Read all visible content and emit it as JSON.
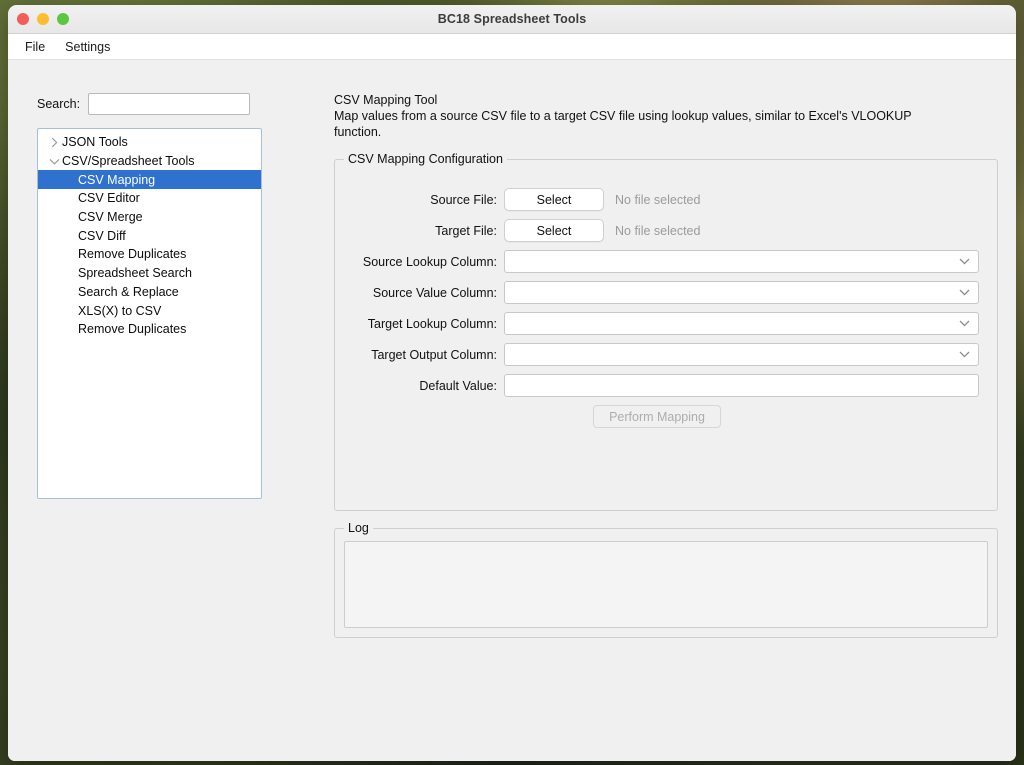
{
  "window": {
    "title": "BC18 Spreadsheet Tools",
    "traffic_lights": [
      "close-red",
      "minimize-yellow",
      "maximize-green"
    ]
  },
  "menubar": {
    "items": [
      {
        "label": "File"
      },
      {
        "label": "Settings"
      }
    ]
  },
  "sidebar": {
    "search": {
      "label": "Search:",
      "value": "",
      "placeholder": ""
    },
    "tree": [
      {
        "label": "JSON Tools",
        "level": 1,
        "arrow": "chevron-right-icon",
        "selected": false
      },
      {
        "label": "CSV/Spreadsheet Tools",
        "level": 1,
        "arrow": "chevron-down-icon",
        "selected": false
      },
      {
        "label": "CSV Mapping",
        "level": 2,
        "arrow": "",
        "selected": true
      },
      {
        "label": "CSV Editor",
        "level": 2,
        "arrow": "",
        "selected": false
      },
      {
        "label": "CSV Merge",
        "level": 2,
        "arrow": "",
        "selected": false
      },
      {
        "label": "CSV Diff",
        "level": 2,
        "arrow": "",
        "selected": false
      },
      {
        "label": "Remove Duplicates",
        "level": 2,
        "arrow": "",
        "selected": false
      },
      {
        "label": "Spreadsheet Search",
        "level": 2,
        "arrow": "",
        "selected": false
      },
      {
        "label": "Search & Replace",
        "level": 2,
        "arrow": "",
        "selected": false
      },
      {
        "label": "XLS(X) to CSV",
        "level": 2,
        "arrow": "",
        "selected": false
      },
      {
        "label": "Remove Duplicates",
        "level": 2,
        "arrow": "",
        "selected": false
      }
    ],
    "selection_color": "#2f71cf"
  },
  "main": {
    "tool_title": "CSV Mapping Tool",
    "tool_description": "Map values from a source CSV file to a target CSV file using lookup values, similar to Excel's VLOOKUP function.",
    "config": {
      "legend": "CSV Mapping Configuration",
      "source_file": {
        "label": "Source File:",
        "button_label": "Select",
        "status": "No file selected"
      },
      "target_file": {
        "label": "Target File:",
        "button_label": "Select",
        "status": "No file selected"
      },
      "source_lookup_column": {
        "label": "Source Lookup Column:",
        "value": "",
        "arrow": "chevron-down-icon"
      },
      "source_value_column": {
        "label": "Source Value Column:",
        "value": "",
        "arrow": "chevron-down-icon"
      },
      "target_lookup_column": {
        "label": "Target Lookup Column:",
        "value": "",
        "arrow": "chevron-down-icon"
      },
      "target_output_column": {
        "label": "Target Output Column:",
        "value": "",
        "arrow": "chevron-down-icon"
      },
      "default_value": {
        "label": "Default Value:",
        "value": "",
        "placeholder": ""
      },
      "perform_button": {
        "label": "Perform Mapping",
        "enabled": false
      }
    },
    "log": {
      "legend": "Log",
      "content": ""
    }
  }
}
